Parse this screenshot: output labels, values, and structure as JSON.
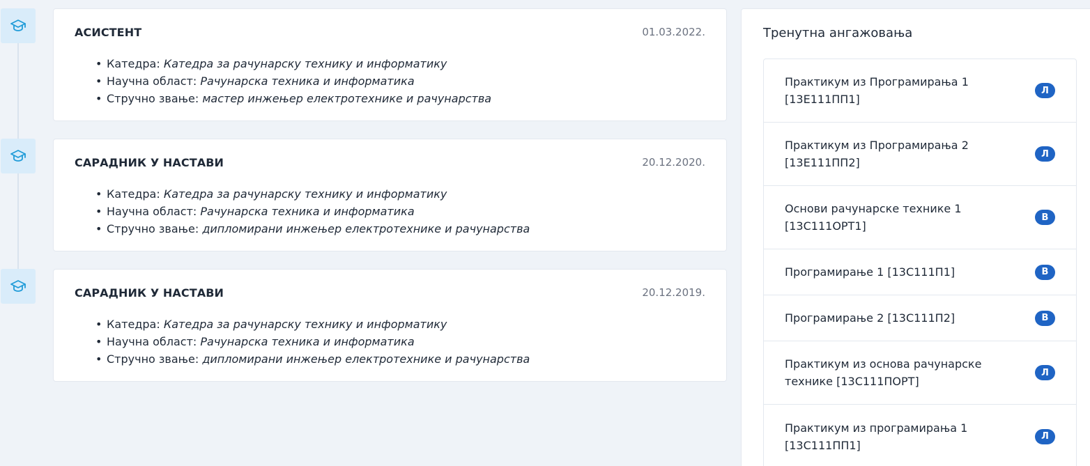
{
  "timeline": {
    "icon": "graduation-cap-icon",
    "icon_color": "#1f9bd8",
    "icon_bg": "#d9ecfa"
  },
  "positions": [
    {
      "title": "АСИСТЕНТ",
      "date": "01.03.2022.",
      "details": [
        {
          "label": "Катедра: ",
          "value": "Катедра за рачунарску технику и информатику"
        },
        {
          "label": "Научна област: ",
          "value": "Рачунарска техника и информатика"
        },
        {
          "label": "Стручно звање: ",
          "value": "мастер инжењер електротехнике и рачунарства"
        }
      ]
    },
    {
      "title": "САРАДНИК У НАСТАВИ",
      "date": "20.12.2020.",
      "details": [
        {
          "label": "Катедра: ",
          "value": "Катедра за рачунарску технику и информатику"
        },
        {
          "label": "Научна област: ",
          "value": "Рачунарска техника и информатика"
        },
        {
          "label": "Стручно звање: ",
          "value": "дипломирани инжењер електротехнике и рачунарства"
        }
      ]
    },
    {
      "title": "САРАДНИК У НАСТАВИ",
      "date": "20.12.2019.",
      "details": [
        {
          "label": "Катедра: ",
          "value": "Катедра за рачунарску технику и информатику"
        },
        {
          "label": "Научна област: ",
          "value": "Рачунарска техника и информатика"
        },
        {
          "label": "Стручно звање: ",
          "value": "дипломирани инжењер електротехнике и рачунарства"
        }
      ]
    }
  ],
  "engagements": {
    "title": "Тренутна ангажовања",
    "badge_color": "#1f64c4",
    "courses": [
      {
        "name": "Практикум из Програмирања 1 [13Е111ПП1]",
        "badge": "Л"
      },
      {
        "name": "Практикум из Програмирања 2 [13Е111ПП2]",
        "badge": "Л"
      },
      {
        "name": "Основи рачунарске технике 1 [13С111ОРТ1]",
        "badge": "В"
      },
      {
        "name": "Програмирање 1 [13С111П1]",
        "badge": "В"
      },
      {
        "name": "Програмирање 2 [13С111П2]",
        "badge": "В"
      },
      {
        "name": "Практикум из основа рачунарске технике [13С111ПОРТ]",
        "badge": "Л"
      },
      {
        "name": "Практикум из програмирања 1 [13С111ПП1]",
        "badge": "Л"
      }
    ]
  }
}
